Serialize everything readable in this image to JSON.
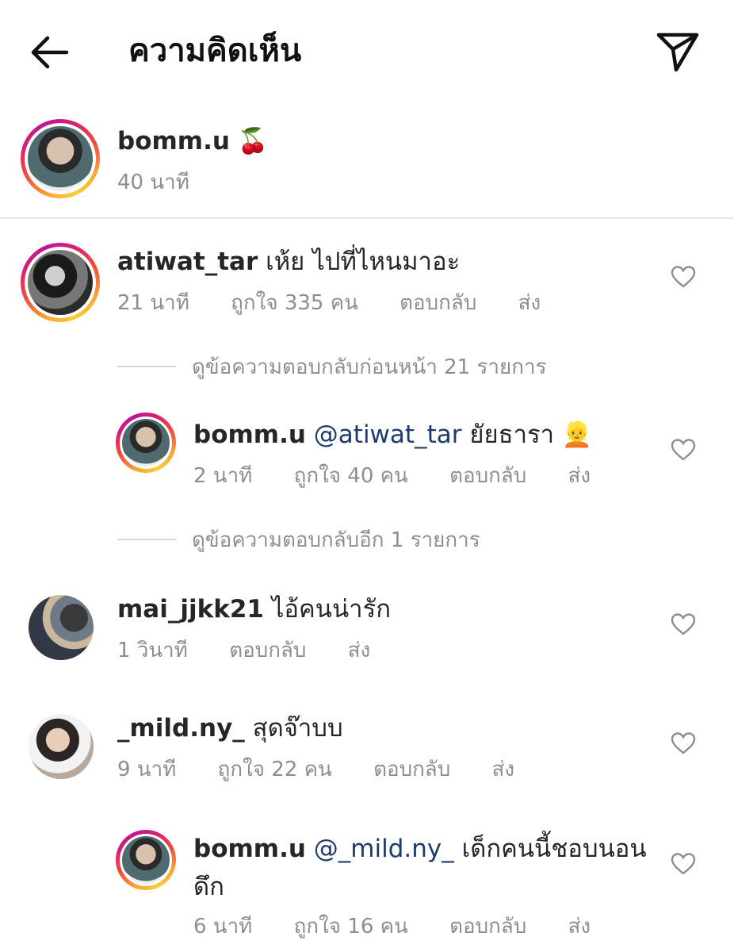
{
  "header": {
    "title": "ความคิดเห็น",
    "back_icon": "arrow-left-icon",
    "send_icon": "paper-plane-icon"
  },
  "caption": {
    "username": "bomm.u",
    "emoji": "🍒",
    "time": "40 นาที"
  },
  "comments": [
    {
      "username": "atiwat_tar",
      "text": "เห้ย ไปที่ไหนมาอะ",
      "time": "21 นาที",
      "likes": "ถูกใจ 335 คน",
      "reply": "ตอบกลับ",
      "send": "ส่ง"
    },
    {
      "view_previous": "ดูข้อความตอบกลับก่อนหน้า 21 รายการ"
    },
    {
      "username": "bomm.u",
      "mention": "@atiwat_tar",
      "text": "ยัยธารา",
      "emoji": "👱",
      "time": "2 นาที",
      "likes": "ถูกใจ 40 คน",
      "reply": "ตอบกลับ",
      "send": "ส่ง"
    },
    {
      "view_more": "ดูข้อความตอบกลับอีก 1 รายการ"
    },
    {
      "username": "mai_jjkk21",
      "text": "ไอ้คนน่ารัก",
      "time": "1 วินาที",
      "reply": "ตอบกลับ",
      "send": "ส่ง"
    },
    {
      "username": "_mild.ny_",
      "text": "สุดจ๊าบบ",
      "time": "9 นาที",
      "likes": "ถูกใจ 22 คน",
      "reply": "ตอบกลับ",
      "send": "ส่ง"
    },
    {
      "username": "bomm.u",
      "mention": "@_mild.ny_",
      "text": "เด็กคนนี้ชอบนอน",
      "text_cont": "ดึก",
      "time": "6 นาที",
      "likes": "ถูกใจ 16 คน",
      "reply": "ตอบกลับ",
      "send": "ส่ง"
    }
  ],
  "icons": {
    "like": "heart-outline-icon"
  },
  "colors": {
    "mention": "#1e3a6e",
    "meta": "#8e8e8e",
    "ring_start": "#f9a533",
    "ring_end": "#c0139a"
  }
}
